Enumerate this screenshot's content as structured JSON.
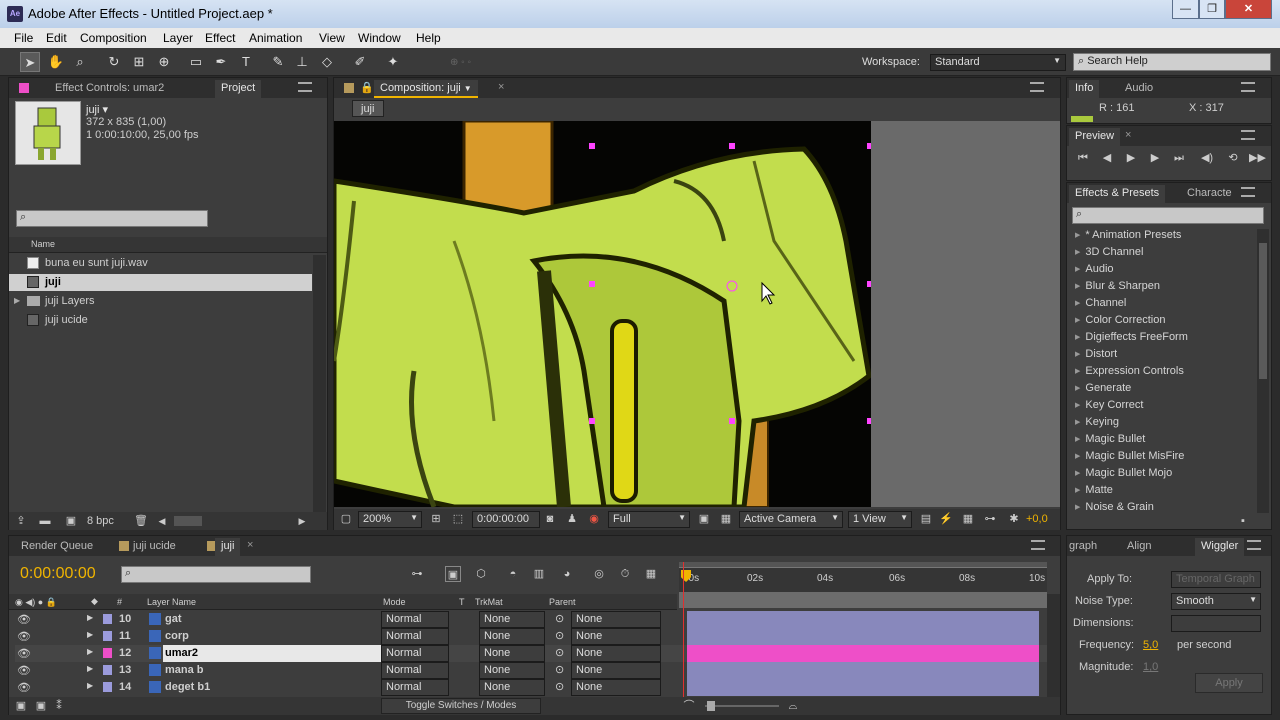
{
  "window": {
    "title": "Adobe After Effects - Untitled Project.aep *",
    "app_icon": "Ae"
  },
  "menu": [
    "File",
    "Edit",
    "Composition",
    "Layer",
    "Effect",
    "Animation",
    "View",
    "Window",
    "Help"
  ],
  "toolbar": {
    "workspace_label": "Workspace:",
    "workspace_value": "Standard",
    "search_placeholder": "Search Help"
  },
  "left_panel": {
    "tabs": [
      "Effect Controls: umar2",
      "Project"
    ],
    "item_name": "juji ▾",
    "item_dims": "372 x 835 (1,00)",
    "item_duration": "1 0:00:10:00, 25,00 fps",
    "column_name": "Name",
    "items": [
      {
        "label": "buna eu sunt juji.wav",
        "icon": "audio-file-icon",
        "selected": false
      },
      {
        "label": "juji",
        "icon": "composition-icon",
        "selected": true
      },
      {
        "label": "juji Layers",
        "icon": "folder-icon",
        "selected": false
      },
      {
        "label": "juji ucide",
        "icon": "composition-icon",
        "selected": false
      }
    ],
    "bpc": "8 bpc"
  },
  "comp_panel": {
    "tab": "Composition: juji",
    "crumb": "juji",
    "zoom": "200%",
    "timecode": "0:00:00:00",
    "resolution": "Full",
    "camera": "Active Camera",
    "views": "1 View",
    "exposure": "+0,0"
  },
  "info_panel": {
    "tabs": [
      "Info",
      "Audio"
    ],
    "r": "R : 161",
    "x": "X : 317"
  },
  "preview_panel": {
    "tab": "Preview"
  },
  "effects_panel": {
    "tabs": [
      "Effects & Presets",
      "Characte"
    ],
    "items": [
      "* Animation Presets",
      "3D Channel",
      "Audio",
      "Blur & Sharpen",
      "Channel",
      "Color Correction",
      "Digieffects FreeForm",
      "Distort",
      "Expression Controls",
      "Generate",
      "Key Correct",
      "Keying",
      "Magic Bullet",
      "Magic Bullet MisFire",
      "Magic Bullet Mojo",
      "Matte",
      "Noise & Grain"
    ]
  },
  "timeline": {
    "tabs": [
      "Render Queue",
      "juji ucide",
      "juji"
    ],
    "timecode": "0:00:00:00",
    "columns": {
      "name": "Layer Name",
      "mode": "Mode",
      "t": "T",
      "trkmat": "TrkMat",
      "parent": "Parent",
      "num": "#"
    },
    "ruler": [
      "00s",
      "02s",
      "04s",
      "06s",
      "08s",
      "10s"
    ],
    "layers": [
      {
        "num": "10",
        "name": "gat",
        "mode": "Normal",
        "trkmat": "None",
        "parent": "None",
        "color": "#9b9bdc",
        "selected": false
      },
      {
        "num": "11",
        "name": "corp",
        "mode": "Normal",
        "trkmat": "None",
        "parent": "None",
        "color": "#9b9bdc",
        "selected": false
      },
      {
        "num": "12",
        "name": "umar2",
        "mode": "Normal",
        "trkmat": "None",
        "parent": "None",
        "color": "#ee4fc8",
        "selected": true
      },
      {
        "num": "13",
        "name": "mana b",
        "mode": "Normal",
        "trkmat": "None",
        "parent": "None",
        "color": "#9b9bdc",
        "selected": false
      },
      {
        "num": "14",
        "name": "deget b1",
        "mode": "Normal",
        "trkmat": "None",
        "parent": "None",
        "color": "#9b9bdc",
        "selected": false
      }
    ],
    "toggle_label": "Toggle Switches / Modes"
  },
  "wiggler": {
    "tabs": [
      "graph",
      "Align",
      "Wiggler"
    ],
    "apply_to_label": "Apply To:",
    "apply_to_value": "Temporal Graph",
    "noise_label": "Noise Type:",
    "noise_value": "Smooth",
    "dimensions_label": "Dimensions:",
    "frequency_label": "Frequency:",
    "frequency_value": "5,0",
    "frequency_unit": "per second",
    "magnitude_label": "Magnitude:",
    "magnitude_value": "1,0",
    "apply_button": "Apply"
  },
  "colors": {
    "accent": "#f0b400",
    "selected_layer": "#ee4fc8",
    "layer_bar": "#9b9bdc"
  }
}
